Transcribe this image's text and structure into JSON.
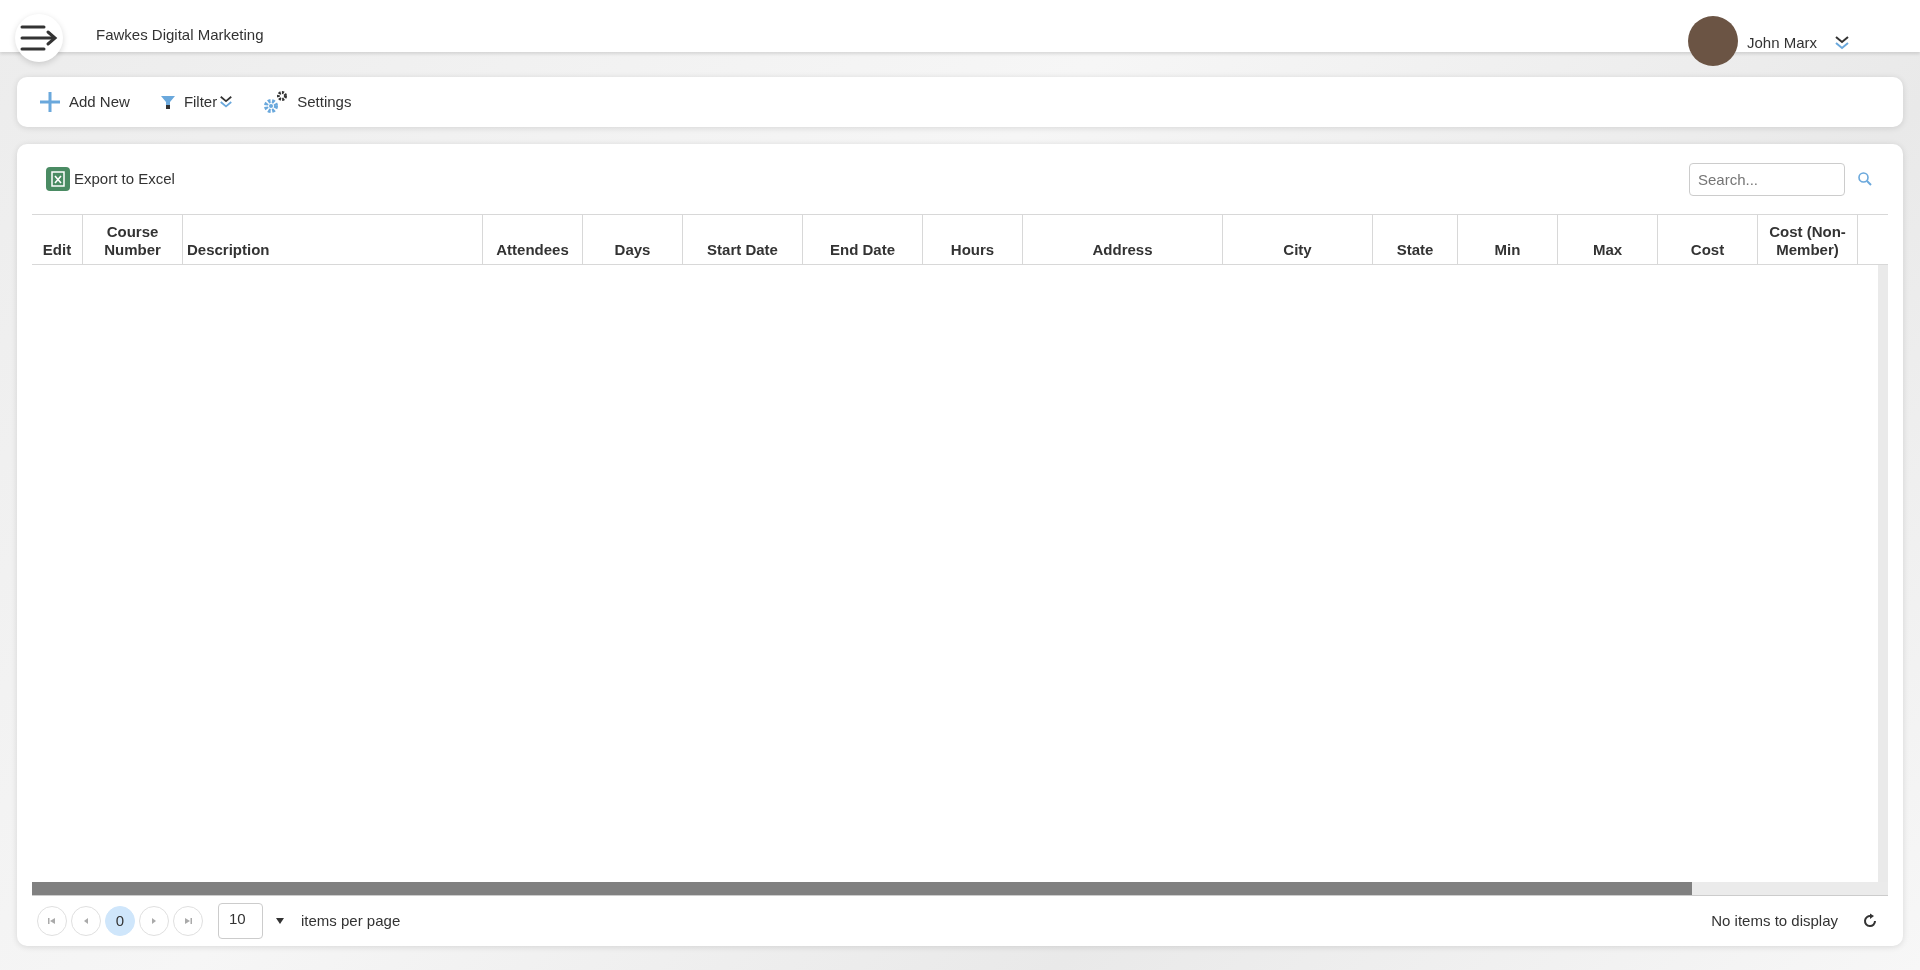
{
  "header": {
    "app_title": "Fawkes Digital Marketing",
    "user_name": "John Marx"
  },
  "toolbar": [
    {
      "label": "Add New",
      "kind": "add"
    },
    {
      "label": "Filter",
      "kind": "filter"
    },
    {
      "label": "Settings",
      "kind": "settings"
    }
  ],
  "grid": {
    "export_label": "Export to Excel",
    "search": {
      "placeholder": "Search..."
    },
    "columns": [
      "Edit",
      "Course Number",
      "Description",
      "Attendees",
      "Days",
      "Start Date",
      "End Date",
      "Hours",
      "Address",
      "City",
      "State",
      "Min",
      "Max",
      "Cost",
      "Cost (Non-Member)"
    ],
    "pager": {
      "pages": [
        {
          "label": "0",
          "selected": true
        }
      ],
      "page_size": "10",
      "page_size_label": "items per page",
      "status": "No items to display"
    }
  }
}
